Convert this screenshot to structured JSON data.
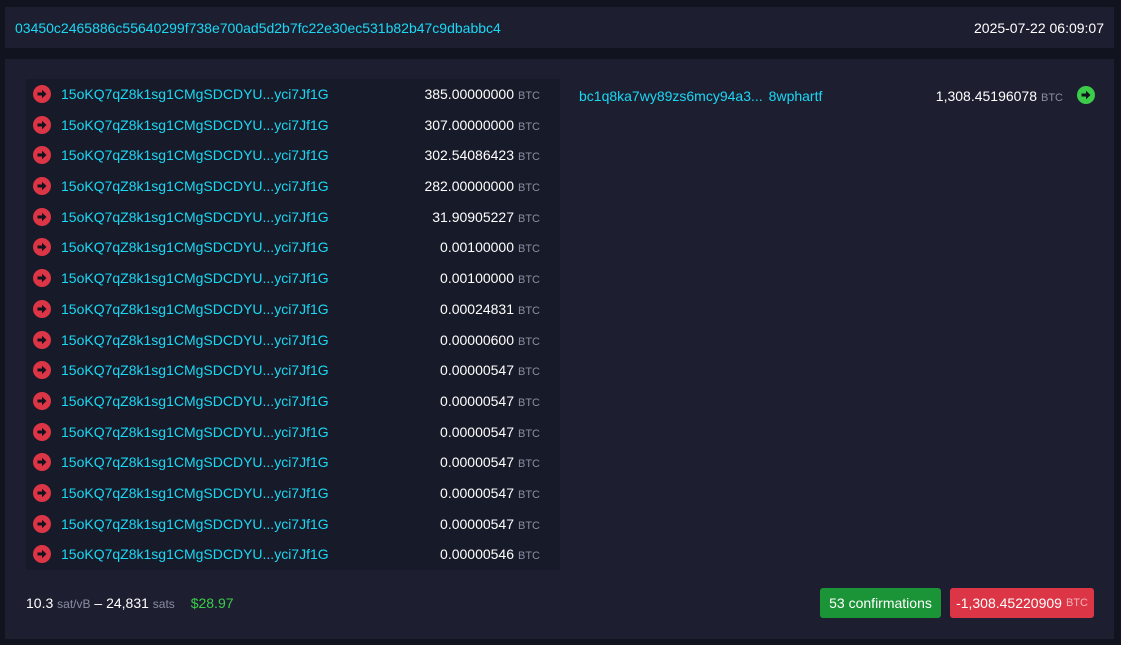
{
  "header": {
    "txid": "03450c2465886c55640299f738e700ad5d2b7fc22e30ec531b82b47c9dbabbc4",
    "timestamp": "2025-07-22 06:09:07"
  },
  "colors": {
    "link": "#1bd8f4",
    "input_arrow": "#dc3545",
    "output_arrow": "#3bcc49",
    "confirmations_bg": "#1a9436",
    "total_bg": "#dc3545"
  },
  "inputs": [
    {
      "address": "15oKQ7qZ8k1sg1CMgSDCDYU...yci7Jf1G",
      "amount": "385.00000000",
      "unit": "BTC",
      "icon": "arrow-right-circle-icon"
    },
    {
      "address": "15oKQ7qZ8k1sg1CMgSDCDYU...yci7Jf1G",
      "amount": "307.00000000",
      "unit": "BTC",
      "icon": "arrow-right-circle-icon"
    },
    {
      "address": "15oKQ7qZ8k1sg1CMgSDCDYU...yci7Jf1G",
      "amount": "302.54086423",
      "unit": "BTC",
      "icon": "arrow-right-circle-icon"
    },
    {
      "address": "15oKQ7qZ8k1sg1CMgSDCDYU...yci7Jf1G",
      "amount": "282.00000000",
      "unit": "BTC",
      "icon": "arrow-right-circle-icon"
    },
    {
      "address": "15oKQ7qZ8k1sg1CMgSDCDYU...yci7Jf1G",
      "amount": "31.90905227",
      "unit": "BTC",
      "icon": "arrow-right-circle-icon"
    },
    {
      "address": "15oKQ7qZ8k1sg1CMgSDCDYU...yci7Jf1G",
      "amount": "0.00100000",
      "unit": "BTC",
      "icon": "arrow-right-circle-icon"
    },
    {
      "address": "15oKQ7qZ8k1sg1CMgSDCDYU...yci7Jf1G",
      "amount": "0.00100000",
      "unit": "BTC",
      "icon": "arrow-right-circle-icon"
    },
    {
      "address": "15oKQ7qZ8k1sg1CMgSDCDYU...yci7Jf1G",
      "amount": "0.00024831",
      "unit": "BTC",
      "icon": "arrow-right-circle-icon"
    },
    {
      "address": "15oKQ7qZ8k1sg1CMgSDCDYU...yci7Jf1G",
      "amount": "0.00000600",
      "unit": "BTC",
      "icon": "arrow-right-circle-icon"
    },
    {
      "address": "15oKQ7qZ8k1sg1CMgSDCDYU...yci7Jf1G",
      "amount": "0.00000547",
      "unit": "BTC",
      "icon": "arrow-right-circle-icon"
    },
    {
      "address": "15oKQ7qZ8k1sg1CMgSDCDYU...yci7Jf1G",
      "amount": "0.00000547",
      "unit": "BTC",
      "icon": "arrow-right-circle-icon"
    },
    {
      "address": "15oKQ7qZ8k1sg1CMgSDCDYU...yci7Jf1G",
      "amount": "0.00000547",
      "unit": "BTC",
      "icon": "arrow-right-circle-icon"
    },
    {
      "address": "15oKQ7qZ8k1sg1CMgSDCDYU...yci7Jf1G",
      "amount": "0.00000547",
      "unit": "BTC",
      "icon": "arrow-right-circle-icon"
    },
    {
      "address": "15oKQ7qZ8k1sg1CMgSDCDYU...yci7Jf1G",
      "amount": "0.00000547",
      "unit": "BTC",
      "icon": "arrow-right-circle-icon"
    },
    {
      "address": "15oKQ7qZ8k1sg1CMgSDCDYU...yci7Jf1G",
      "amount": "0.00000547",
      "unit": "BTC",
      "icon": "arrow-right-circle-icon"
    },
    {
      "address": "15oKQ7qZ8k1sg1CMgSDCDYU...yci7Jf1G",
      "amount": "0.00000546",
      "unit": "BTC",
      "icon": "arrow-right-circle-icon"
    }
  ],
  "outputs": [
    {
      "address_start": "bc1q8ka7wy89zs6mcy94a3...",
      "address_end": "8wphartf",
      "amount": "1,308.45196078",
      "unit": "BTC",
      "icon": "arrow-right-circle-icon"
    }
  ],
  "footer": {
    "fee_rate": "10.3",
    "fee_rate_unit": "sat/vB",
    "separator": "–",
    "fee_sats": "24,831",
    "fee_sats_unit": "sats",
    "fee_usd": "$28.97",
    "confirmations": "53 confirmations",
    "total": "-1,308.45220909",
    "total_unit": "BTC"
  }
}
